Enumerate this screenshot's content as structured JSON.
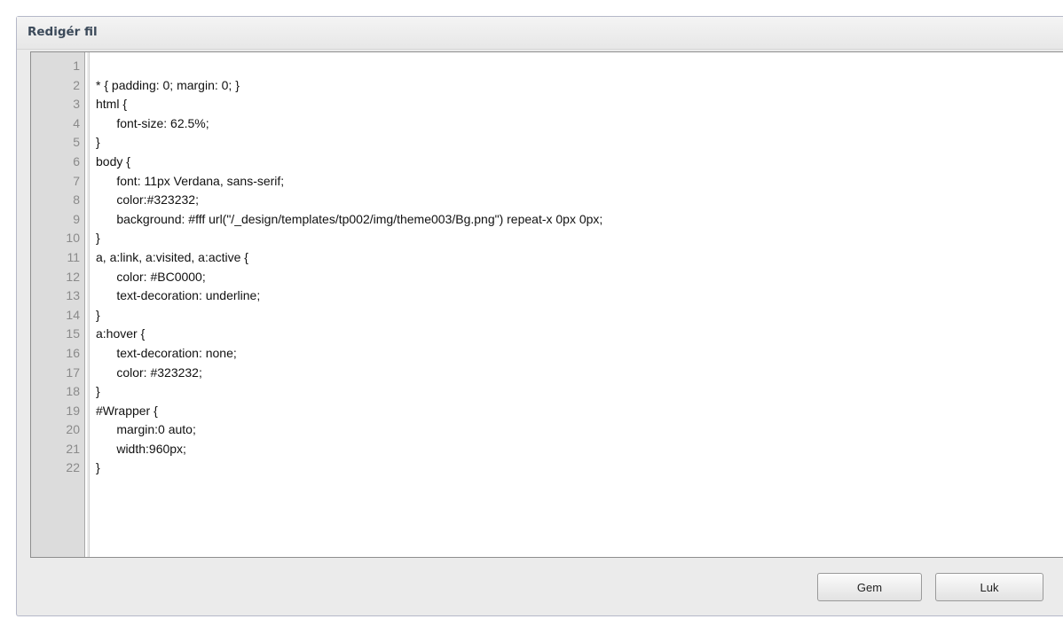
{
  "dialog": {
    "title": "Redigér fil"
  },
  "editor": {
    "lines": [
      {
        "num": "1",
        "text": ""
      },
      {
        "num": "2",
        "text": "* { padding: 0; margin: 0; }"
      },
      {
        "num": "3",
        "text": "html {"
      },
      {
        "num": "4",
        "text": "      font-size: 62.5%;"
      },
      {
        "num": "5",
        "text": "}"
      },
      {
        "num": "6",
        "text": "body {"
      },
      {
        "num": "7",
        "text": "      font: 11px Verdana, sans-serif;"
      },
      {
        "num": "8",
        "text": "      color:#323232;"
      },
      {
        "num": "9",
        "text": "      background: #fff url(\"/_design/templates/tp002/img/theme003/Bg.png\") repeat-x 0px 0px;"
      },
      {
        "num": "10",
        "text": "}"
      },
      {
        "num": "11",
        "text": "a, a:link, a:visited, a:active {"
      },
      {
        "num": "12",
        "text": "      color: #BC0000;"
      },
      {
        "num": "13",
        "text": "      text-decoration: underline;"
      },
      {
        "num": "14",
        "text": "}"
      },
      {
        "num": "15",
        "text": "a:hover {"
      },
      {
        "num": "16",
        "text": "      text-decoration: none;"
      },
      {
        "num": "17",
        "text": "      color: #323232;"
      },
      {
        "num": "18",
        "text": "}"
      },
      {
        "num": "19",
        "text": "#Wrapper {"
      },
      {
        "num": "20",
        "text": "      margin:0 auto;"
      },
      {
        "num": "21",
        "text": "      width:960px;"
      },
      {
        "num": "22",
        "text": "}"
      }
    ]
  },
  "buttons": {
    "save_label": "Gem",
    "close_label": "Luk"
  }
}
